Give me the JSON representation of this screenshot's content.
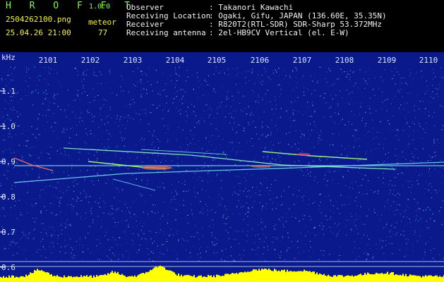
{
  "app": {
    "name": "H R O F F T",
    "version": "1.0.0"
  },
  "file": {
    "name": "2504262100.png",
    "timestamp": "25.04.26 21:00"
  },
  "detector": {
    "label": "meteor",
    "count": "77"
  },
  "station": [
    {
      "label": "Observer",
      "value": ": Takanori Kawachi"
    },
    {
      "label": "Receiving Location",
      "value": ": Ogaki, Gifu, JAPAN (136.60E, 35.35N)"
    },
    {
      "label": "Receiver",
      "value": ": R820T2(RTL-SDR) SDR-Sharp 53.372MHz"
    },
    {
      "label": "Receiving antenna",
      "value": ": 2el-HB9CV Vertical (el. E-W)"
    }
  ],
  "spectrogram": {
    "unit": "kHz",
    "time_ticks": [
      "2101",
      "2102",
      "2103",
      "2104",
      "2105",
      "2106",
      "2107",
      "2108",
      "2109",
      "2110"
    ],
    "freq_ticks": [
      "1.1",
      "1.0",
      "0.9",
      "0.8",
      "0.7",
      "0.6"
    ],
    "colors": {
      "background": "#0A1A8C",
      "header_text": "#7CFC4A",
      "label_text": "#F4F24A",
      "signal_bar": "#FFFF00"
    }
  }
}
